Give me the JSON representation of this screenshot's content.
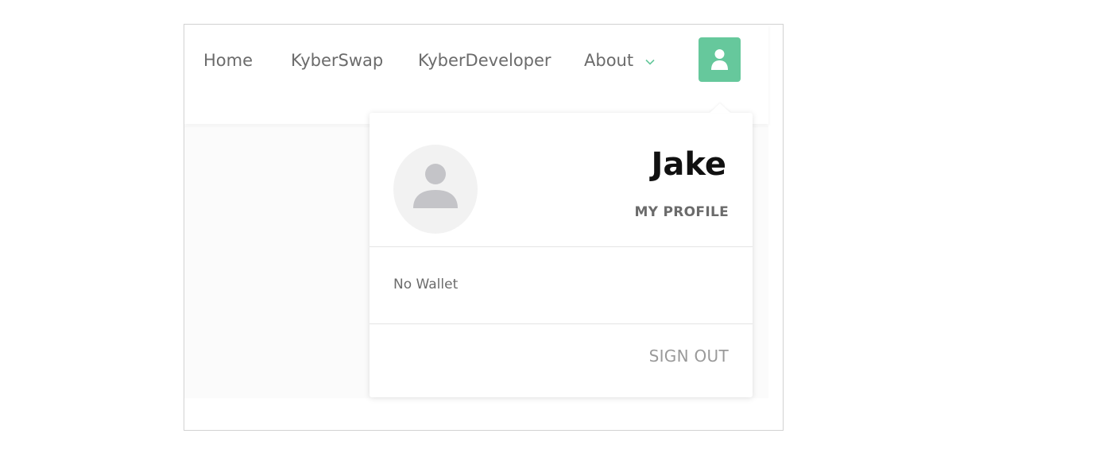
{
  "nav": {
    "items": [
      {
        "label": "Home"
      },
      {
        "label": "KyberSwap"
      },
      {
        "label": "KyberDeveloper"
      },
      {
        "label": "About"
      }
    ],
    "about_icon": "chevron-down-icon",
    "user_button_icon": "user-icon"
  },
  "profile_menu": {
    "avatar_icon": "avatar-placeholder-icon",
    "user_name": "Jake",
    "my_profile_label": "MY PROFILE",
    "wallet_status": "No Wallet",
    "sign_out_label": "SIGN OUT"
  },
  "colors": {
    "accent": "#66c89c",
    "text_muted": "#6b6b6b",
    "sign_out": "#9a9a9a",
    "avatar_bg": "#f2f2f2",
    "avatar_icon": "#c4c4c8"
  }
}
